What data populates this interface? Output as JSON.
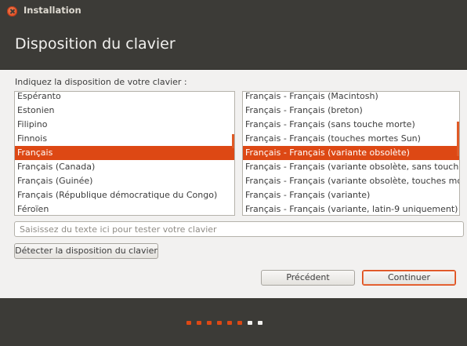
{
  "window": {
    "title": "Installation"
  },
  "header": {
    "title": "Disposition du clavier"
  },
  "prompt": "Indiquez la disposition de votre clavier :",
  "layouts": [
    {
      "label": "Espéranto",
      "selected": false
    },
    {
      "label": "Estonien",
      "selected": false
    },
    {
      "label": "Filipino",
      "selected": false
    },
    {
      "label": "Finnois",
      "selected": false
    },
    {
      "label": "Français",
      "selected": true
    },
    {
      "label": "Français (Canada)",
      "selected": false
    },
    {
      "label": "Français (Guinée)",
      "selected": false
    },
    {
      "label": "Français (République démocratique du Congo)",
      "selected": false
    },
    {
      "label": "Féroïen",
      "selected": false
    }
  ],
  "variants": [
    {
      "label": "Français - Français (Macintosh)",
      "selected": false
    },
    {
      "label": "Français - Français (breton)",
      "selected": false
    },
    {
      "label": "Français - Français (sans touche morte)",
      "selected": false
    },
    {
      "label": "Français - Français (touches mortes Sun)",
      "selected": false
    },
    {
      "label": "Français - Français (variante obsolète)",
      "selected": true
    },
    {
      "label": "Français - Français (variante obsolète, sans touche morte)",
      "selected": false
    },
    {
      "label": "Français - Français (variante obsolète, touches mortes Sun)",
      "selected": false
    },
    {
      "label": "Français - Français (variante)",
      "selected": false
    },
    {
      "label": "Français - Français (variante, latin-9 uniquement)",
      "selected": false
    }
  ],
  "test_input": {
    "placeholder": "Saisissez du texte ici pour tester votre clavier",
    "value": ""
  },
  "buttons": {
    "detect": "Détecter la disposition du clavier",
    "previous": "Précédent",
    "next": "Continuer"
  },
  "progress": {
    "completed_steps": 6,
    "total_steps": 8
  },
  "colors": {
    "accent": "#dd4814",
    "chrome": "#3c3b37",
    "content_bg": "#f2f1f0"
  }
}
